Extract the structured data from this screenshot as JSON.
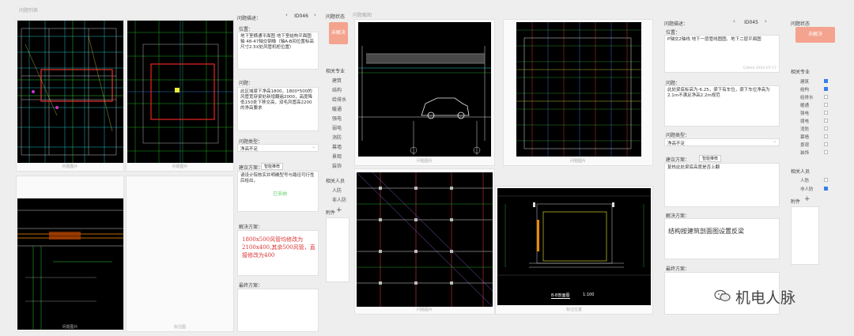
{
  "left_panel": {
    "header": "问题列表",
    "captions": [
      "问题图片",
      "问题图片",
      "问题图片",
      "标注图"
    ]
  },
  "issue1": {
    "desc_label": "问题描述：",
    "id": "ID046",
    "location_label": "位置：",
    "location_text": "地下室横通平面图 地下室结构平面图 轴 48-47轴交钢橡（轴A-B间位置标高尺寸2.5X处风管机柜位置）",
    "problem_label": "问题：",
    "problem_text": "此区域梁下净高1800，1800*500的风管宽穿梁处新增翻遍2000，高度降低150处下移交高，双毛风管高2200的净高要求",
    "type_label": "问题类型：",
    "type_value": "净高不足",
    "suggest_label": "建议方案：",
    "suggest_tab": "智能推荐",
    "suggest_text": "请设计院核实并明确型号与路径可行性后给出，",
    "green_text": "已采纳",
    "solution_label": "解决方案：",
    "solution_text": "1800x500风管均修改为2100x400,其余500风管，直接修改为400",
    "final_label": "最终方案：",
    "status_label": "问题状态",
    "status_btn": "未解决",
    "specialty_label": "相关专业",
    "specialties": [
      "建筑",
      "结构",
      "给排水",
      "暖通",
      "强电",
      "弱电",
      "消防",
      "幕墙",
      "景观",
      "装饰"
    ],
    "people_label": "相关人员",
    "people": [
      "人防",
      "非人防"
    ],
    "attach_label": "附件",
    "attach_plus": "+"
  },
  "middle_panel": {
    "header": "问题截图",
    "captions": [
      "问题图片",
      "问题图片",
      "问题图片",
      "标注位置"
    ]
  },
  "issue2": {
    "desc_label": "问题描述：",
    "id": "ID045",
    "location_label": "位置：",
    "location_text": "P轴交2轴线 地下一层管线图图、地下二层平面图",
    "problem_label": "问题：",
    "problem_text": "此处梁底标高为-6.25，梁下有车位，梁下车位净高为2.1m不满足净高2.2m规范",
    "type_label": "问题类型：",
    "type_value": "净高不足",
    "suggest_label": "建议方案：",
    "suggest_tab": "智能推荐",
    "suggest_text": "复核此处梁底高度是否上翻",
    "solution_label": "解决方案：",
    "solution_text": "结构按建筑剖面图设置反梁",
    "final_label": "最终方案：",
    "status_label": "问题状态",
    "status_btn": "未解决",
    "specialty_label": "相关专业",
    "specialties": [
      "建筑",
      "结构",
      "给排水",
      "暖通",
      "强电",
      "弱电",
      "消防",
      "幕墙",
      "景观",
      "装饰"
    ],
    "people_label": "相关人员",
    "people": [
      "人防",
      "非人防"
    ],
    "attach_label": "附件",
    "attach_plus": "+"
  },
  "section_title": "B-B剖面图",
  "section_scale": "1:100",
  "watermark": "机电人脉"
}
